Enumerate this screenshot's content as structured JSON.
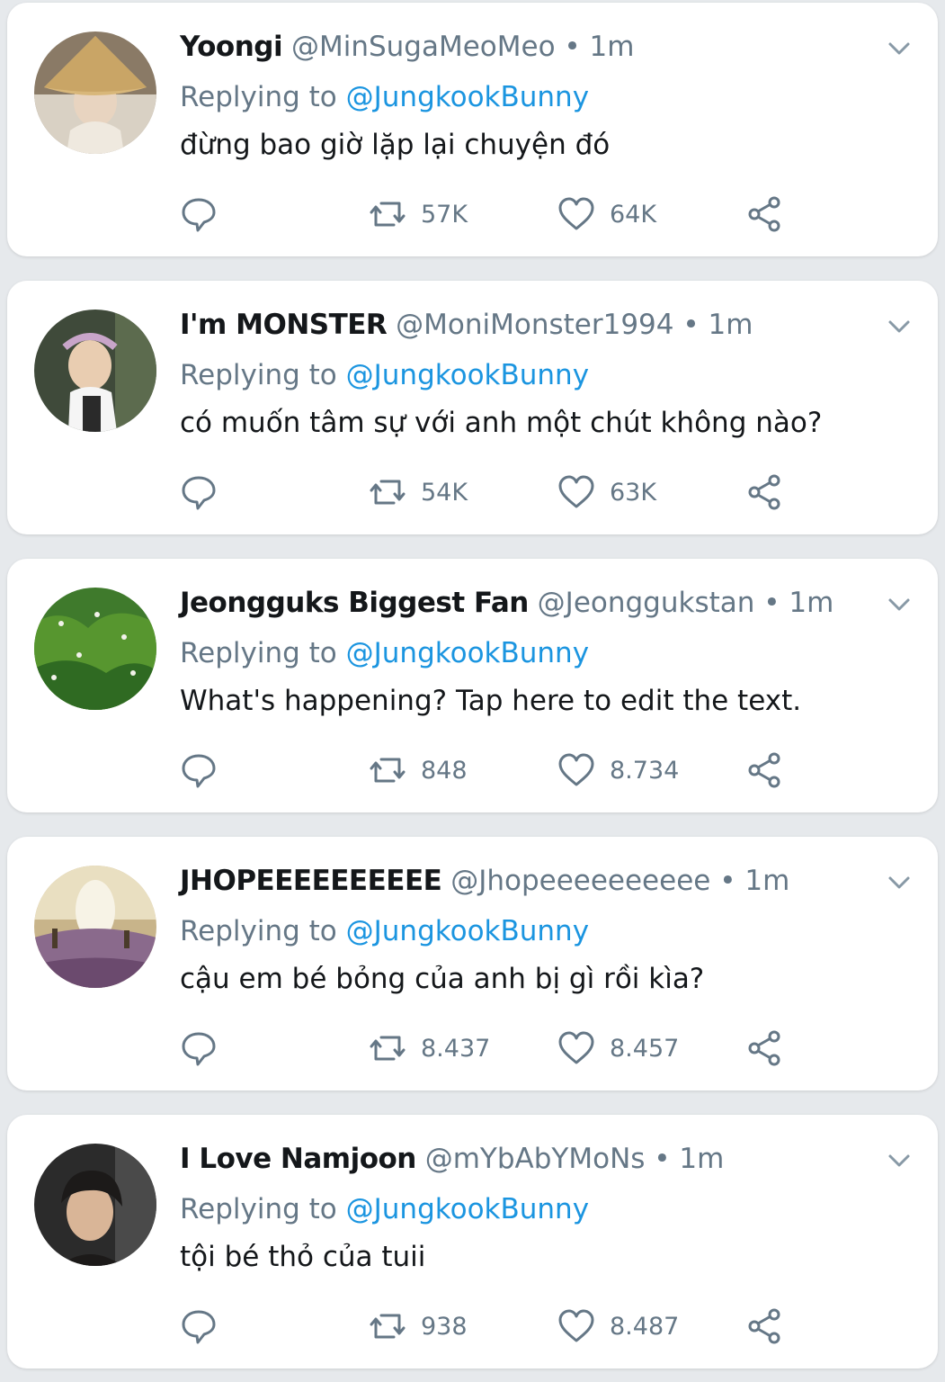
{
  "colors": {
    "background": "#e6e9ec",
    "card": "#ffffff",
    "link": "#1b95e0",
    "muted": "#657786",
    "text": "#14171a"
  },
  "icons": {
    "reply": "comment-bubble-icon",
    "retweet": "retweet-icon",
    "like": "heart-icon",
    "share": "share-icon",
    "menu": "chevron-down-icon"
  },
  "tweets": [
    {
      "name": "Yoongi",
      "handle": "@MinSugaMeoMeo",
      "dot": "•",
      "time": "1m",
      "replying_label": "Replying to",
      "replying_to": "@JungkookBunny",
      "text": "đừng bao giờ lặp lại chuyện đó",
      "retweets": "57K",
      "likes": "64K"
    },
    {
      "name": "I'm MONSTER",
      "handle": "@MoniMonster1994",
      "dot": "•",
      "time": "1m",
      "replying_label": "Replying to",
      "replying_to": "@JungkookBunny",
      "text": "có muốn tâm sự với anh một chút không nào?",
      "retweets": "54K",
      "likes": "63K"
    },
    {
      "name": "Jeongguks Biggest Fan",
      "handle": "@Jeonggukstan",
      "dot": "•",
      "time": "1m",
      "replying_label": "Replying to",
      "replying_to": "@JungkookBunny",
      "text": "What's happening? Tap here to edit the text.",
      "retweets": "848",
      "likes": "8.734"
    },
    {
      "name": "JHOPEEEEEEEEEE",
      "handle": "@Jhopeeeeeeeeee",
      "dot": "•",
      "time": "1m",
      "replying_label": "Replying to",
      "replying_to": "@JungkookBunny",
      "text": "cậu em bé bỏng của anh bị gì rồi kìa?",
      "retweets": "8.437",
      "likes": "8.457"
    },
    {
      "name": "I Love Namjoon",
      "handle": "@mYbAbYMoNs",
      "dot": "•",
      "time": "1m",
      "replying_label": "Replying to",
      "replying_to": "@JungkookBunny",
      "text": "tội bé thỏ của tuii",
      "retweets": "938",
      "likes": "8.487"
    }
  ]
}
